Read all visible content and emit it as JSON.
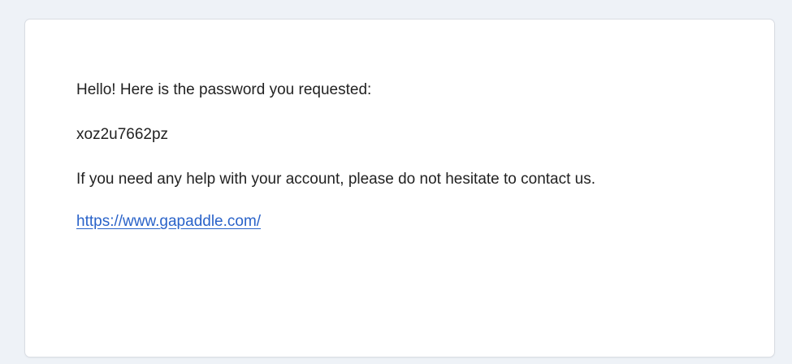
{
  "email": {
    "greeting": "Hello! Here is the password you requested:",
    "password": "xoz2u7662pz",
    "help_text": "If you need any help with your account, please do not hesitate to contact us.",
    "link_text": "https://www.gapaddle.com/"
  },
  "colors": {
    "background": "#eef2f7",
    "card": "#ffffff",
    "border": "#d9dde3",
    "text": "#222222",
    "link": "#2a63c9"
  }
}
